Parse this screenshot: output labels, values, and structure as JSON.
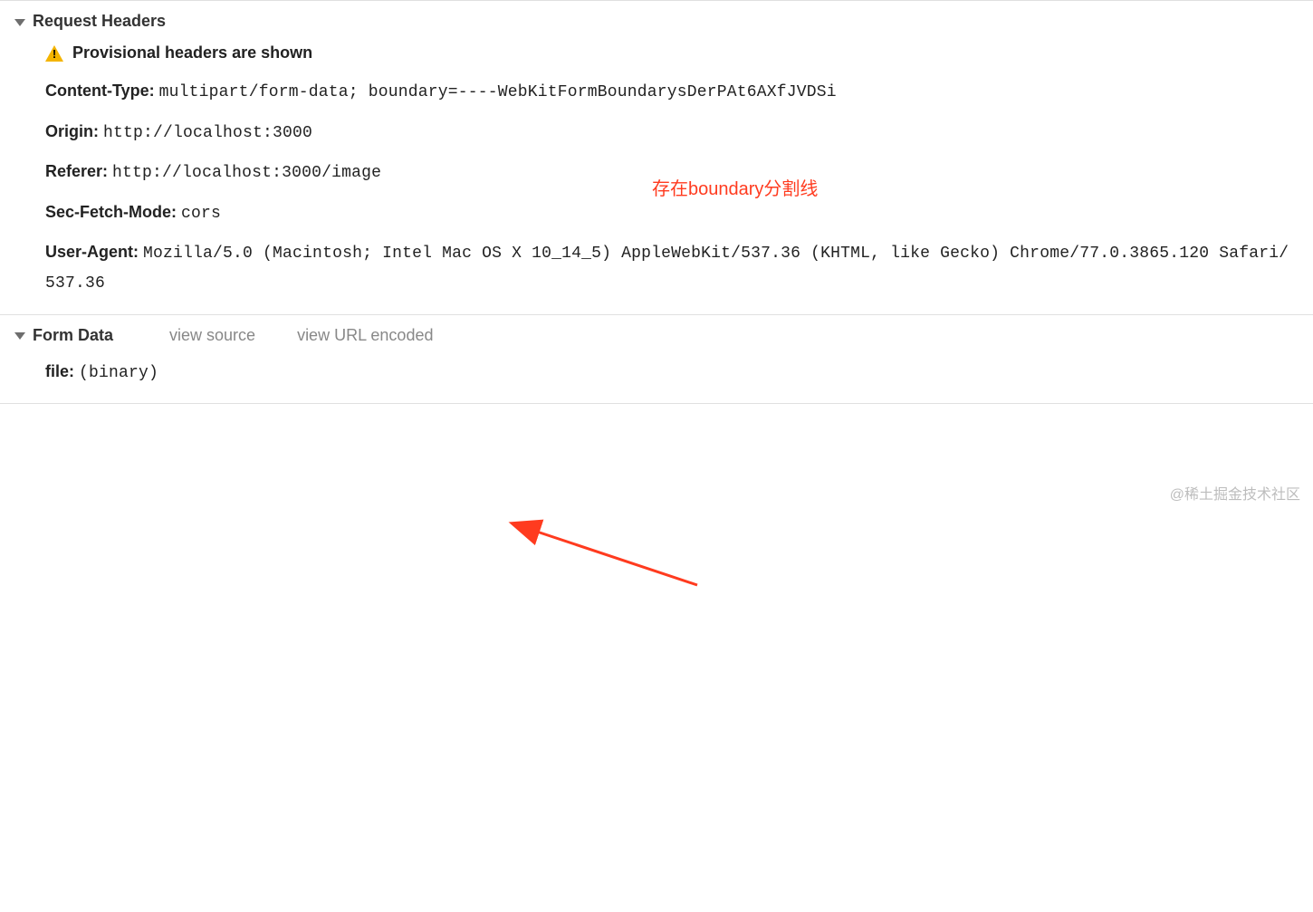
{
  "sections": {
    "requestHeaders": {
      "title": "Request Headers",
      "warning": "Provisional headers are shown",
      "headers": {
        "contentType": {
          "key": "Content-Type:",
          "value": "multipart/form-data; boundary=----WebKitFormBoundarysDerPAt6AXfJVDSi"
        },
        "origin": {
          "key": "Origin:",
          "value": "http://localhost:3000"
        },
        "referer": {
          "key": "Referer:",
          "value": "http://localhost:3000/image"
        },
        "secFetchMode": {
          "key": "Sec-Fetch-Mode:",
          "value": "cors"
        },
        "userAgent": {
          "key": "User-Agent:",
          "value": "Mozilla/5.0 (Macintosh; Intel Mac OS X 10_14_5) AppleWebKit/537.36 (KHTML, like Gecko) Chrome/77.0.3865.120 Safari/537.36"
        }
      }
    },
    "formData": {
      "title": "Form Data",
      "links": {
        "viewSource": "view source",
        "viewUrlEncoded": "view URL encoded"
      },
      "fields": {
        "file": {
          "key": "file:",
          "value": "(binary)"
        }
      }
    }
  },
  "annotation": {
    "text": "存在boundary分割线",
    "arrowColor": "#ff3b1f"
  },
  "watermark": "@稀土掘金技术社区"
}
